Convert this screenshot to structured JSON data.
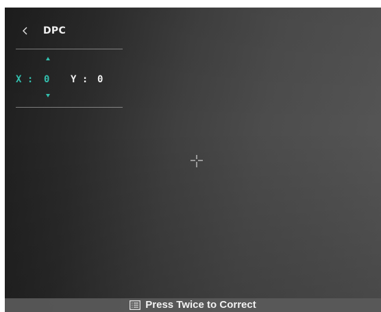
{
  "header": {
    "back_icon": "chevron-left-icon",
    "title": "DPC"
  },
  "coordinates": {
    "x_label": "X :",
    "x_value": "0",
    "y_label": "Y :",
    "y_value": "0",
    "up_icon": "triangle-up-icon",
    "down_icon": "triangle-down-icon"
  },
  "center": {
    "icon": "crosshair-icon"
  },
  "footer": {
    "icon": "menu-icon",
    "hint": "Press Twice to Correct"
  },
  "colors": {
    "accent": "#33bfae",
    "text": "#f0f0f0",
    "footer_bg": "#5a5a5a"
  }
}
